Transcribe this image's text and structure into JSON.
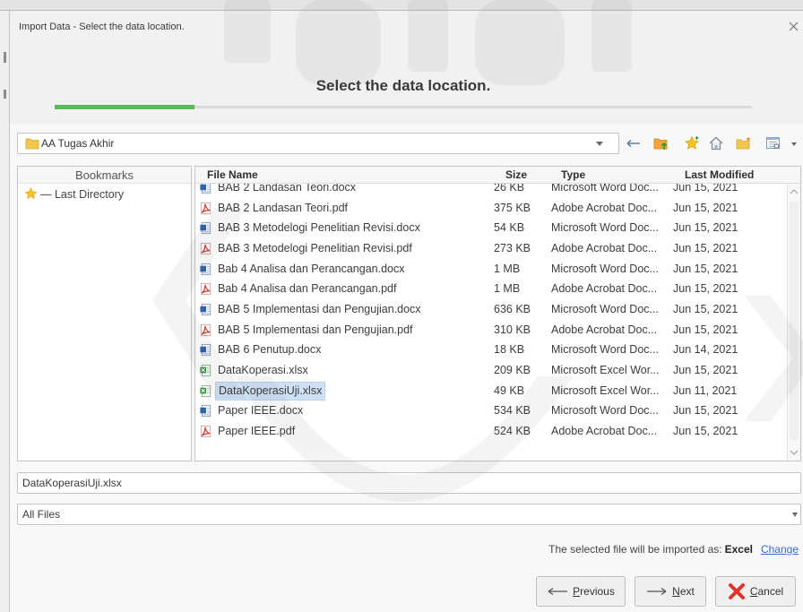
{
  "window": {
    "title": "Import Data - Select the data location.",
    "close_icon": "close-icon"
  },
  "wizard": {
    "heading": "Select the data location.",
    "progress_fraction": 0.2
  },
  "location": {
    "current_folder": "AA Tugas Akhir",
    "folder_icon": "folder-icon",
    "toolbar_icons": [
      "back-arrow-icon",
      "folder-up-icon",
      "add-bookmark-star-icon",
      "home-icon",
      "new-folder-icon",
      "view-options-icon"
    ]
  },
  "bookmarks": {
    "header": "Bookmarks",
    "items": [
      {
        "label": "— Last Directory",
        "icon": "star-icon"
      }
    ]
  },
  "files": {
    "columns": {
      "name": "File Name",
      "size": "Size",
      "type": "Type",
      "modified": "Last Modified"
    },
    "rows": [
      {
        "name": "BAB 2 Landasan Teori.docx",
        "size": "26 KB",
        "type": "Microsoft Word Doc...",
        "modified": "Jun 15, 2021",
        "icon": "word-file-icon"
      },
      {
        "name": "BAB 2 Landasan Teori.pdf",
        "size": "375 KB",
        "type": "Adobe Acrobat Doc...",
        "modified": "Jun 15, 2021",
        "icon": "pdf-file-icon"
      },
      {
        "name": "BAB 3 Metodelogi Penelitian Revisi.docx",
        "size": "54 KB",
        "type": "Microsoft Word Doc...",
        "modified": "Jun 15, 2021",
        "icon": "word-file-icon"
      },
      {
        "name": "BAB 3 Metodelogi Penelitian Revisi.pdf",
        "size": "273 KB",
        "type": "Adobe Acrobat Doc...",
        "modified": "Jun 15, 2021",
        "icon": "pdf-file-icon"
      },
      {
        "name": "Bab 4 Analisa dan Perancangan.docx",
        "size": "1 MB",
        "type": "Microsoft Word Doc...",
        "modified": "Jun 15, 2021",
        "icon": "word-file-icon"
      },
      {
        "name": "Bab 4 Analisa dan Perancangan.pdf",
        "size": "1 MB",
        "type": "Adobe Acrobat Doc...",
        "modified": "Jun 15, 2021",
        "icon": "pdf-file-icon"
      },
      {
        "name": "BAB 5 Implementasi dan Pengujian.docx",
        "size": "636 KB",
        "type": "Microsoft Word Doc...",
        "modified": "Jun 15, 2021",
        "icon": "word-file-icon"
      },
      {
        "name": "BAB 5 Implementasi dan Pengujian.pdf",
        "size": "310 KB",
        "type": "Adobe Acrobat Doc...",
        "modified": "Jun 15, 2021",
        "icon": "pdf-file-icon"
      },
      {
        "name": "BAB 6 Penutup.docx",
        "size": "18 KB",
        "type": "Microsoft Word Doc...",
        "modified": "Jun 14, 2021",
        "icon": "word-file-icon"
      },
      {
        "name": "DataKoperasi.xlsx",
        "size": "209 KB",
        "type": "Microsoft Excel Wor...",
        "modified": "Jun 15, 2021",
        "icon": "excel-file-icon"
      },
      {
        "name": "DataKoperasiUji.xlsx",
        "size": "49 KB",
        "type": "Microsoft Excel Wor...",
        "modified": "Jun 11, 2021",
        "icon": "excel-file-icon",
        "selected": true
      },
      {
        "name": "Paper IEEE.docx",
        "size": "534 KB",
        "type": "Microsoft Word Doc...",
        "modified": "Jun 15, 2021",
        "icon": "word-file-icon"
      },
      {
        "name": "Paper IEEE.pdf",
        "size": "524 KB",
        "type": "Adobe Acrobat Doc...",
        "modified": "Jun 15, 2021",
        "icon": "pdf-file-icon"
      }
    ]
  },
  "filename_field": {
    "value": "DataKoperasiUji.xlsx"
  },
  "filter": {
    "value": "All Files"
  },
  "import_note": {
    "prefix": "The selected file will be imported as:",
    "format": "Excel",
    "change_link": "Change"
  },
  "buttons": {
    "previous": {
      "label": "Previous",
      "icon": "arrow-left-icon"
    },
    "next": {
      "label": "Next",
      "icon": "arrow-right-icon"
    },
    "cancel": {
      "label": "Cancel",
      "icon": "cancel-x-icon"
    }
  },
  "colors": {
    "accent": "#5cb85c",
    "selection": "#cfe2f5",
    "link": "#3768d3",
    "cancel_icon": "#e0332b"
  }
}
